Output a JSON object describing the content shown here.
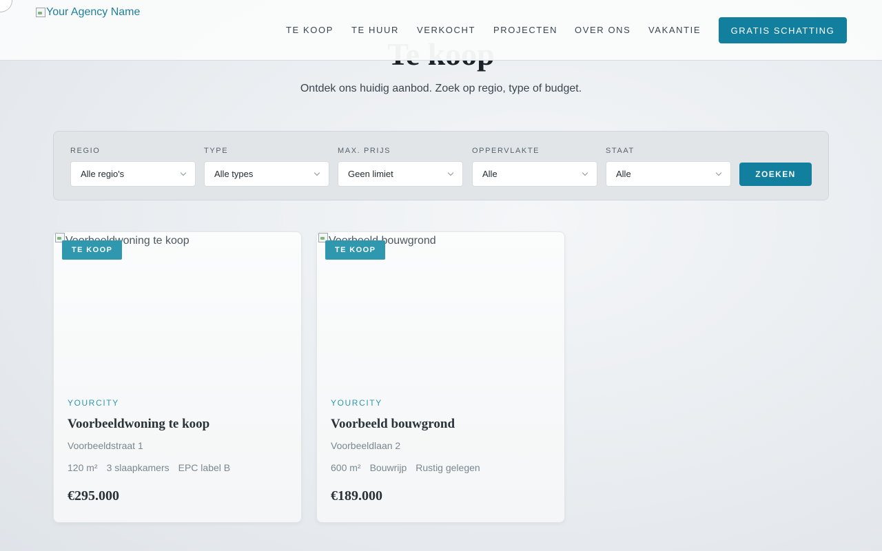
{
  "header": {
    "logo_alt": "Your Agency Name",
    "nav": [
      {
        "label": "TE KOOP"
      },
      {
        "label": "TE HUUR"
      },
      {
        "label": "VERKOCHT"
      },
      {
        "label": "PROJECTEN"
      },
      {
        "label": "OVER ONS"
      },
      {
        "label": "VAKANTIE"
      }
    ],
    "cta_label": "GRATIS SCHATTING"
  },
  "hero": {
    "title": "Te koop",
    "subtitle": "Ontdek ons huidig aanbod. Zoek op regio, type of budget."
  },
  "filters": {
    "fields": [
      {
        "label": "REGIO",
        "value": "Alle regio's"
      },
      {
        "label": "TYPE",
        "value": "Alle types"
      },
      {
        "label": "MAX. PRIJS",
        "value": "Geen limiet"
      },
      {
        "label": "OPPERVLAKTE",
        "value": "Alle"
      },
      {
        "label": "STAAT",
        "value": "Alle"
      }
    ],
    "search_label": "ZOEKEN"
  },
  "listings": [
    {
      "image_alt": "Voorbeeldwoning te koop",
      "badge": "TE KOOP",
      "city": "YOURCITY",
      "title": "Voorbeeldwoning te koop",
      "address": "Voorbeeldstraat 1",
      "features": [
        "120 m²",
        "3 slaapkamers",
        "EPC label B"
      ],
      "price": "€295.000"
    },
    {
      "image_alt": "Voorbeeld bouwgrond",
      "badge": "TE KOOP",
      "city": "YOURCITY",
      "title": "Voorbeeld bouwgrond",
      "address": "Voorbeeldlaan 2",
      "features": [
        "600 m²",
        "Bouwrijp",
        "Rustig gelegen"
      ],
      "price": "€189.000"
    }
  ]
}
